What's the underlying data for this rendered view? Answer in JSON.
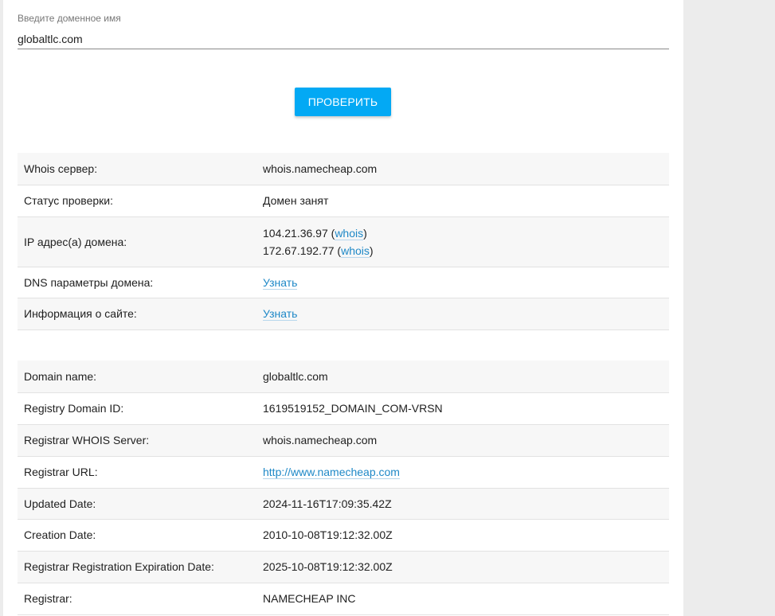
{
  "domain_field": {
    "label": "Введите доменное имя",
    "value": "globaltlc.com"
  },
  "check_button": {
    "label": "ПРОВЕРИТЬ"
  },
  "summary": {
    "whois_server": {
      "label": "Whois сервер:",
      "value": "whois.namecheap.com"
    },
    "status": {
      "label": "Статус проверки:",
      "value": "Домен занят"
    },
    "ips": {
      "label": "IP адрес(а) домена:",
      "items": [
        {
          "ip": "104.21.36.97",
          "link": "whois"
        },
        {
          "ip": "172.67.192.77",
          "link": "whois"
        }
      ]
    },
    "dns": {
      "label": "DNS параметры домена:",
      "link": "Узнать"
    },
    "site_info": {
      "label": "Информация о сайте:",
      "link": "Узнать"
    }
  },
  "whois": {
    "rows": [
      {
        "label": "Domain name:",
        "value": "globaltlc.com"
      },
      {
        "label": "Registry Domain ID:",
        "value": "1619519152_DOMAIN_COM-VRSN"
      },
      {
        "label": "Registrar WHOIS Server:",
        "value": "whois.namecheap.com"
      },
      {
        "label": "Registrar URL:",
        "value": "http://www.namecheap.com"
      },
      {
        "label": "Updated Date:",
        "value": "2024-11-16T17:09:35.42Z"
      },
      {
        "label": "Creation Date:",
        "value": "2010-10-08T19:12:32.00Z"
      },
      {
        "label": "Registrar Registration Expiration Date:",
        "value": "2025-10-08T19:12:32.00Z"
      },
      {
        "label": "Registrar:",
        "value": "NAMECHEAP INC"
      }
    ]
  }
}
